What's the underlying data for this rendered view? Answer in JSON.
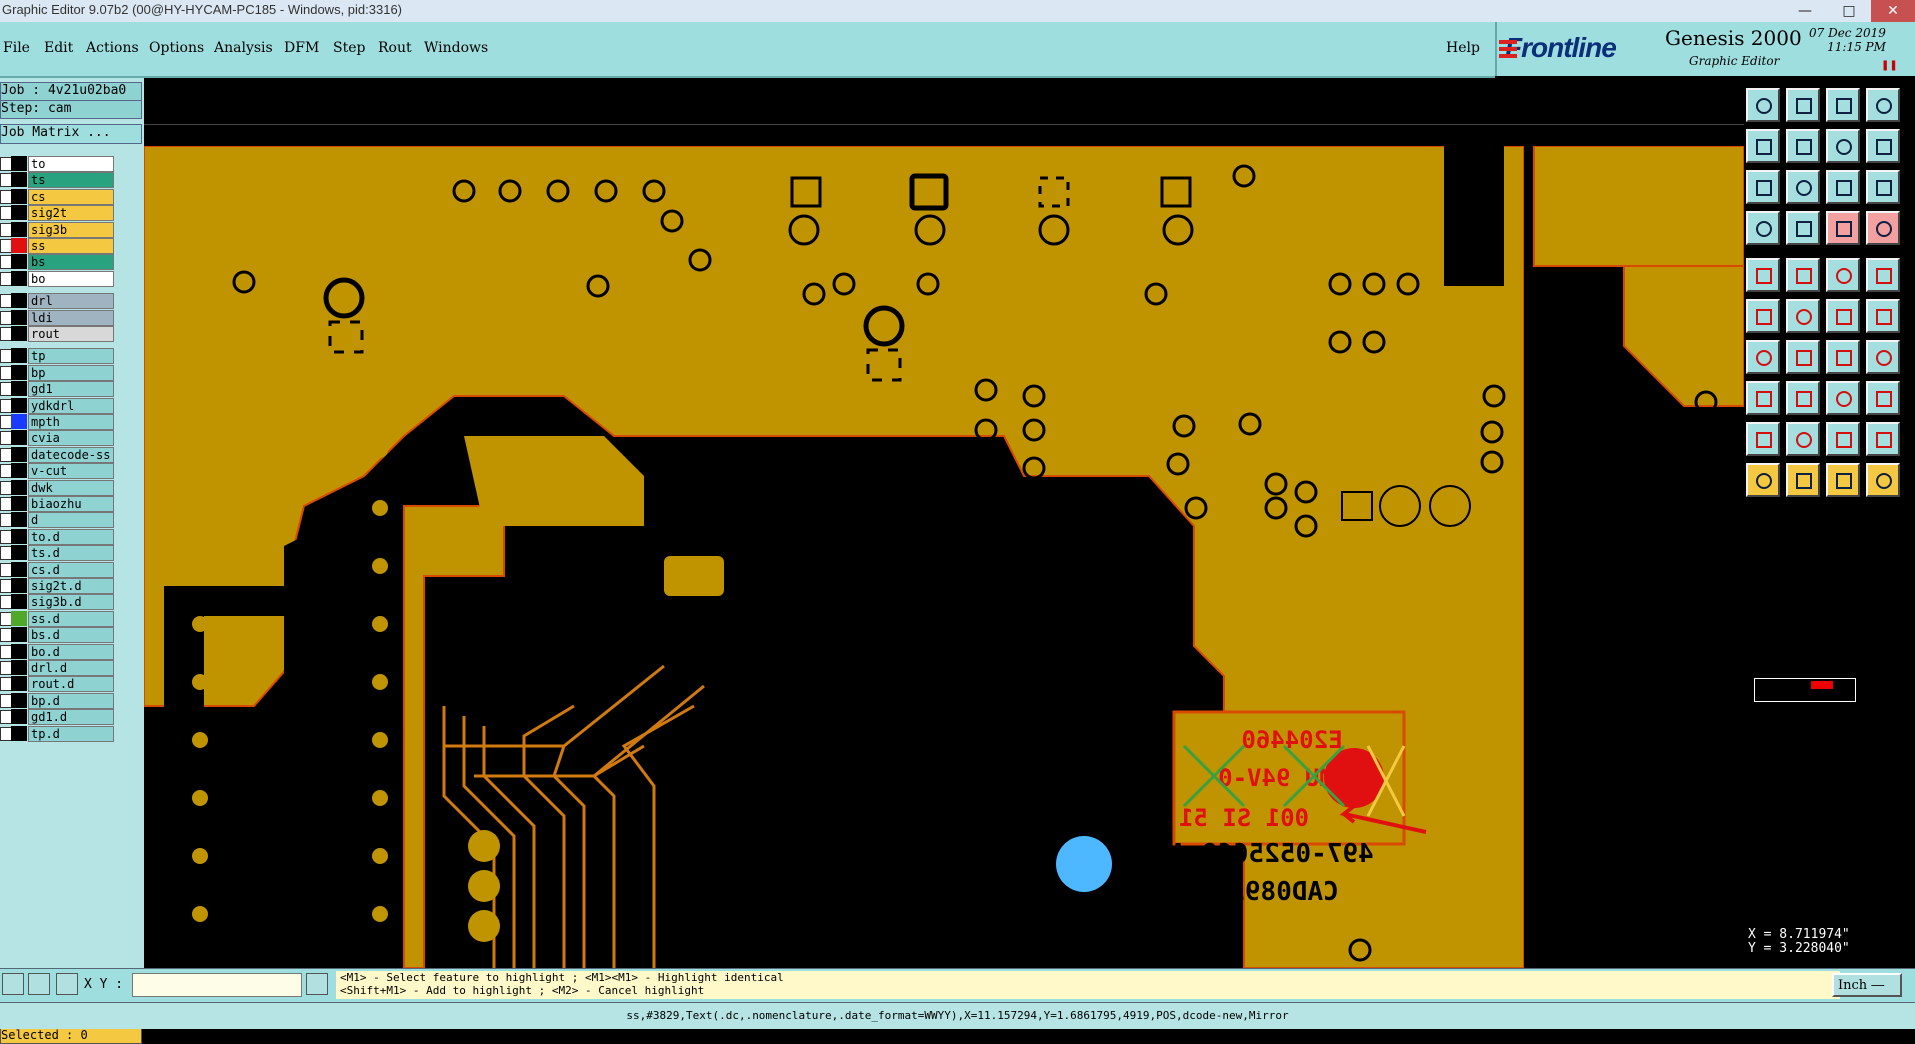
{
  "window": {
    "title": "Graphic Editor 9.07b2 (00@HY-HYCAM-PC185 - Windows, pid:3316)"
  },
  "menu": {
    "items": [
      "File",
      "Edit",
      "Actions",
      "Options",
      "Analysis",
      "DFM",
      "Step",
      "Rout",
      "Windows"
    ],
    "help": "Help"
  },
  "brand": {
    "logo": "Frontline",
    "product": "Genesis 2000",
    "subtitle": "Graphic Editor",
    "date": "07 Dec 2019",
    "time": "11:15 PM"
  },
  "job": {
    "job": "Job : 4v21u02ba0",
    "step": "Step: cam",
    "matrix": "Job Matrix ..."
  },
  "layers": [
    {
      "name": "to",
      "color": "#ffffff",
      "sw": "#000000"
    },
    {
      "name": "ts",
      "color": "#29a37f",
      "sw": "#000000"
    },
    {
      "name": "cs",
      "color": "#f5c842",
      "sw": "#000000"
    },
    {
      "name": "sig2t",
      "color": "#f5c842",
      "sw": "#000000"
    },
    {
      "name": "sig3b",
      "color": "#f5c842",
      "sw": "#000000"
    },
    {
      "name": "ss",
      "color": "#f5c842",
      "sw": "#e01010"
    },
    {
      "name": "bs",
      "color": "#29a37f",
      "sw": "#000000"
    },
    {
      "name": "bo",
      "color": "#ffffff",
      "sw": "#000000"
    },
    {
      "name": "drl",
      "color": "#9fb3c0",
      "sw": "#000000"
    },
    {
      "name": "ldi",
      "color": "#9fb3c0",
      "sw": "#000000"
    },
    {
      "name": "rout",
      "color": "#d8d8d8",
      "sw": "#000000"
    },
    {
      "name": "tp",
      "color": "#8fd2d2",
      "sw": "#000000"
    },
    {
      "name": "bp",
      "color": "#8fd2d2",
      "sw": "#000000"
    },
    {
      "name": "gd1",
      "color": "#8fd2d2",
      "sw": "#000000"
    },
    {
      "name": "ydkdrl",
      "color": "#8fd2d2",
      "sw": "#000000"
    },
    {
      "name": "mpth",
      "color": "#8fd2d2",
      "sw": "#1a3bff"
    },
    {
      "name": "cvia",
      "color": "#8fd2d2",
      "sw": "#000000"
    },
    {
      "name": "datecode-ss",
      "color": "#8fd2d2",
      "sw": "#000000"
    },
    {
      "name": "v-cut",
      "color": "#8fd2d2",
      "sw": "#000000"
    },
    {
      "name": "dwk",
      "color": "#8fd2d2",
      "sw": "#000000"
    },
    {
      "name": "biaozhu",
      "color": "#8fd2d2",
      "sw": "#000000"
    },
    {
      "name": "d",
      "color": "#8fd2d2",
      "sw": "#000000"
    },
    {
      "name": "to.d",
      "color": "#8fd2d2",
      "sw": "#000000"
    },
    {
      "name": "ts.d",
      "color": "#8fd2d2",
      "sw": "#000000"
    },
    {
      "name": "cs.d",
      "color": "#8fd2d2",
      "sw": "#000000"
    },
    {
      "name": "sig2t.d",
      "color": "#8fd2d2",
      "sw": "#000000"
    },
    {
      "name": "sig3b.d",
      "color": "#8fd2d2",
      "sw": "#000000"
    },
    {
      "name": "ss.d",
      "color": "#8fd2d2",
      "sw": "#4fa82c"
    },
    {
      "name": "bs.d",
      "color": "#8fd2d2",
      "sw": "#000000"
    },
    {
      "name": "bo.d",
      "color": "#8fd2d2",
      "sw": "#000000"
    },
    {
      "name": "drl.d",
      "color": "#8fd2d2",
      "sw": "#000000"
    },
    {
      "name": "rout.d",
      "color": "#8fd2d2",
      "sw": "#000000"
    },
    {
      "name": "bp.d",
      "color": "#8fd2d2",
      "sw": "#000000"
    },
    {
      "name": "gd1.d",
      "color": "#8fd2d2",
      "sw": "#000000"
    },
    {
      "name": "tp.d",
      "color": "#8fd2d2",
      "sw": "#000000"
    }
  ],
  "selected": "Selected : 0",
  "canvas": {
    "copper_color": "#c09400",
    "silk_texts": [
      "E204460",
      "MU 94V-0",
      "001 SI 51",
      "497-0525669 A",
      "CAD0892"
    ]
  },
  "coords": {
    "x": "X = 8.711974\"",
    "y": "Y = 3.228040\""
  },
  "bottom": {
    "xy_label": "X Y :",
    "xy_value": "",
    "hint1": "<M1> - Select feature to highlight ; <M1><M1> - Highlight identical",
    "hint2": "<Shift+M1> - Add to highlight ; <M2> - Cancel highlight",
    "units": "Inch"
  },
  "status": "ss,#3829,Text(.dc,.nomenclature,.date_format=WWYY),X=11.157294,Y=1.6861795,4919,POS,dcode-new,Mirror"
}
